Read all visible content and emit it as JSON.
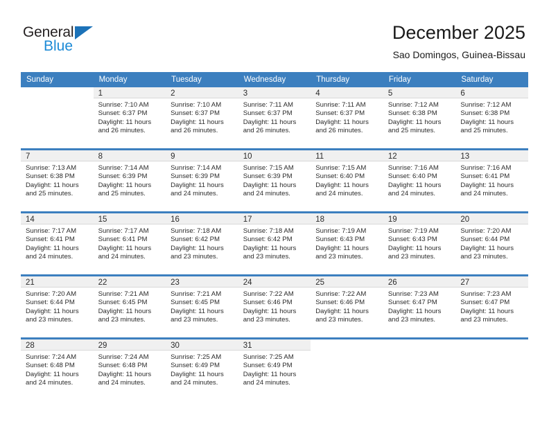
{
  "brand": {
    "name_top": "General",
    "name_bottom": "Blue",
    "accent_color": "#1c8ad6",
    "triangle_color": "#1c72b8"
  },
  "header": {
    "title": "December 2025",
    "subtitle": "Sao Domingos, Guinea-Bissau"
  },
  "calendar": {
    "header_bg": "#3c7fbf",
    "header_text_color": "#ffffff",
    "daynum_bg": "#f0f0f0",
    "weekdays": [
      "Sunday",
      "Monday",
      "Tuesday",
      "Wednesday",
      "Thursday",
      "Friday",
      "Saturday"
    ],
    "weeks": [
      [
        {
          "day": "",
          "lines": []
        },
        {
          "day": "1",
          "lines": [
            "Sunrise: 7:10 AM",
            "Sunset: 6:37 PM",
            "Daylight: 11 hours",
            "and 26 minutes."
          ]
        },
        {
          "day": "2",
          "lines": [
            "Sunrise: 7:10 AM",
            "Sunset: 6:37 PM",
            "Daylight: 11 hours",
            "and 26 minutes."
          ]
        },
        {
          "day": "3",
          "lines": [
            "Sunrise: 7:11 AM",
            "Sunset: 6:37 PM",
            "Daylight: 11 hours",
            "and 26 minutes."
          ]
        },
        {
          "day": "4",
          "lines": [
            "Sunrise: 7:11 AM",
            "Sunset: 6:37 PM",
            "Daylight: 11 hours",
            "and 26 minutes."
          ]
        },
        {
          "day": "5",
          "lines": [
            "Sunrise: 7:12 AM",
            "Sunset: 6:38 PM",
            "Daylight: 11 hours",
            "and 25 minutes."
          ]
        },
        {
          "day": "6",
          "lines": [
            "Sunrise: 7:12 AM",
            "Sunset: 6:38 PM",
            "Daylight: 11 hours",
            "and 25 minutes."
          ]
        }
      ],
      [
        {
          "day": "7",
          "lines": [
            "Sunrise: 7:13 AM",
            "Sunset: 6:38 PM",
            "Daylight: 11 hours",
            "and 25 minutes."
          ]
        },
        {
          "day": "8",
          "lines": [
            "Sunrise: 7:14 AM",
            "Sunset: 6:39 PM",
            "Daylight: 11 hours",
            "and 25 minutes."
          ]
        },
        {
          "day": "9",
          "lines": [
            "Sunrise: 7:14 AM",
            "Sunset: 6:39 PM",
            "Daylight: 11 hours",
            "and 24 minutes."
          ]
        },
        {
          "day": "10",
          "lines": [
            "Sunrise: 7:15 AM",
            "Sunset: 6:39 PM",
            "Daylight: 11 hours",
            "and 24 minutes."
          ]
        },
        {
          "day": "11",
          "lines": [
            "Sunrise: 7:15 AM",
            "Sunset: 6:40 PM",
            "Daylight: 11 hours",
            "and 24 minutes."
          ]
        },
        {
          "day": "12",
          "lines": [
            "Sunrise: 7:16 AM",
            "Sunset: 6:40 PM",
            "Daylight: 11 hours",
            "and 24 minutes."
          ]
        },
        {
          "day": "13",
          "lines": [
            "Sunrise: 7:16 AM",
            "Sunset: 6:41 PM",
            "Daylight: 11 hours",
            "and 24 minutes."
          ]
        }
      ],
      [
        {
          "day": "14",
          "lines": [
            "Sunrise: 7:17 AM",
            "Sunset: 6:41 PM",
            "Daylight: 11 hours",
            "and 24 minutes."
          ]
        },
        {
          "day": "15",
          "lines": [
            "Sunrise: 7:17 AM",
            "Sunset: 6:41 PM",
            "Daylight: 11 hours",
            "and 24 minutes."
          ]
        },
        {
          "day": "16",
          "lines": [
            "Sunrise: 7:18 AM",
            "Sunset: 6:42 PM",
            "Daylight: 11 hours",
            "and 23 minutes."
          ]
        },
        {
          "day": "17",
          "lines": [
            "Sunrise: 7:18 AM",
            "Sunset: 6:42 PM",
            "Daylight: 11 hours",
            "and 23 minutes."
          ]
        },
        {
          "day": "18",
          "lines": [
            "Sunrise: 7:19 AM",
            "Sunset: 6:43 PM",
            "Daylight: 11 hours",
            "and 23 minutes."
          ]
        },
        {
          "day": "19",
          "lines": [
            "Sunrise: 7:19 AM",
            "Sunset: 6:43 PM",
            "Daylight: 11 hours",
            "and 23 minutes."
          ]
        },
        {
          "day": "20",
          "lines": [
            "Sunrise: 7:20 AM",
            "Sunset: 6:44 PM",
            "Daylight: 11 hours",
            "and 23 minutes."
          ]
        }
      ],
      [
        {
          "day": "21",
          "lines": [
            "Sunrise: 7:20 AM",
            "Sunset: 6:44 PM",
            "Daylight: 11 hours",
            "and 23 minutes."
          ]
        },
        {
          "day": "22",
          "lines": [
            "Sunrise: 7:21 AM",
            "Sunset: 6:45 PM",
            "Daylight: 11 hours",
            "and 23 minutes."
          ]
        },
        {
          "day": "23",
          "lines": [
            "Sunrise: 7:21 AM",
            "Sunset: 6:45 PM",
            "Daylight: 11 hours",
            "and 23 minutes."
          ]
        },
        {
          "day": "24",
          "lines": [
            "Sunrise: 7:22 AM",
            "Sunset: 6:46 PM",
            "Daylight: 11 hours",
            "and 23 minutes."
          ]
        },
        {
          "day": "25",
          "lines": [
            "Sunrise: 7:22 AM",
            "Sunset: 6:46 PM",
            "Daylight: 11 hours",
            "and 23 minutes."
          ]
        },
        {
          "day": "26",
          "lines": [
            "Sunrise: 7:23 AM",
            "Sunset: 6:47 PM",
            "Daylight: 11 hours",
            "and 23 minutes."
          ]
        },
        {
          "day": "27",
          "lines": [
            "Sunrise: 7:23 AM",
            "Sunset: 6:47 PM",
            "Daylight: 11 hours",
            "and 23 minutes."
          ]
        }
      ],
      [
        {
          "day": "28",
          "lines": [
            "Sunrise: 7:24 AM",
            "Sunset: 6:48 PM",
            "Daylight: 11 hours",
            "and 24 minutes."
          ]
        },
        {
          "day": "29",
          "lines": [
            "Sunrise: 7:24 AM",
            "Sunset: 6:48 PM",
            "Daylight: 11 hours",
            "and 24 minutes."
          ]
        },
        {
          "day": "30",
          "lines": [
            "Sunrise: 7:25 AM",
            "Sunset: 6:49 PM",
            "Daylight: 11 hours",
            "and 24 minutes."
          ]
        },
        {
          "day": "31",
          "lines": [
            "Sunrise: 7:25 AM",
            "Sunset: 6:49 PM",
            "Daylight: 11 hours",
            "and 24 minutes."
          ]
        },
        {
          "day": "",
          "lines": []
        },
        {
          "day": "",
          "lines": []
        },
        {
          "day": "",
          "lines": []
        }
      ]
    ]
  }
}
